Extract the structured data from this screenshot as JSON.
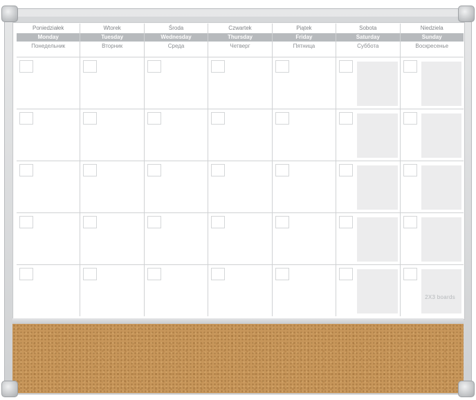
{
  "days": [
    {
      "pl": "Poniedziałek",
      "en": "Monday",
      "ru": "Понедельник",
      "weekend": false
    },
    {
      "pl": "Wtorek",
      "en": "Tuesday",
      "ru": "Вторник",
      "weekend": false
    },
    {
      "pl": "Środa",
      "en": "Wednesday",
      "ru": "Среда",
      "weekend": false
    },
    {
      "pl": "Czwartek",
      "en": "Thursday",
      "ru": "Четверг",
      "weekend": false
    },
    {
      "pl": "Piątek",
      "en": "Friday",
      "ru": "Пятница",
      "weekend": false
    },
    {
      "pl": "Sobota",
      "en": "Saturday",
      "ru": "Суббота",
      "weekend": true
    },
    {
      "pl": "Niedziela",
      "en": "Sunday",
      "ru": "Воскресенье",
      "weekend": true
    }
  ],
  "week_count": 5,
  "brand": "2X3 boards",
  "colors": {
    "frame": "#d6d8da",
    "header_band": "#b7babd",
    "weekend_shade": "#ececed",
    "cork": "#c7965a"
  }
}
